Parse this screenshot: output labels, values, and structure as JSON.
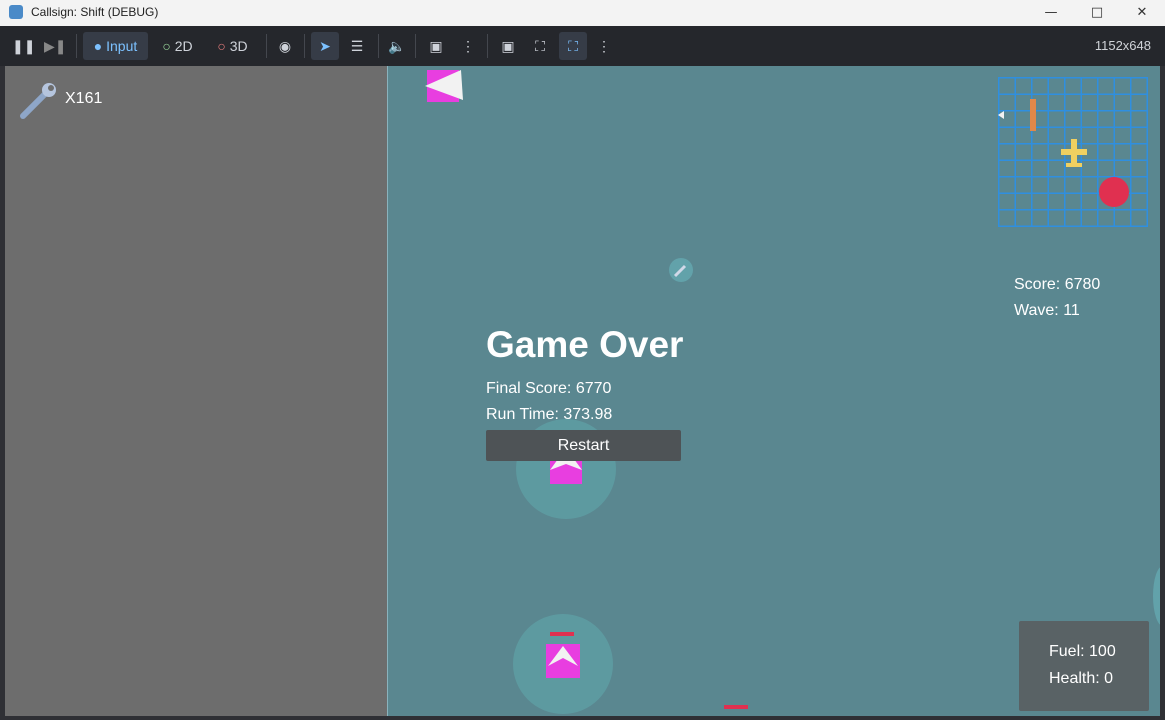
{
  "window": {
    "title": "Callsign: Shift (DEBUG)"
  },
  "toolbar": {
    "input_label": "Input",
    "mode_2d": "2D",
    "mode_3d": "3D",
    "resolution": "1152x648"
  },
  "hud": {
    "ammo_count": "X161",
    "score": "Score: 6780",
    "wave": "Wave: 11",
    "fuel": "Fuel: 100",
    "health": "Health: 0"
  },
  "game_over": {
    "title": "Game Over",
    "final_score": "Final Score: 6770",
    "run_time": "Run Time: 373.98",
    "restart_label": "Restart"
  },
  "colors": {
    "viewport_bg": "#5a8790",
    "left_panel": "#6d6d6d",
    "enemy_magenta": "#e83ee0",
    "minimap_grid": "#2f8fe0",
    "player_yellow": "#f0d060",
    "danger_red": "#e03050"
  }
}
